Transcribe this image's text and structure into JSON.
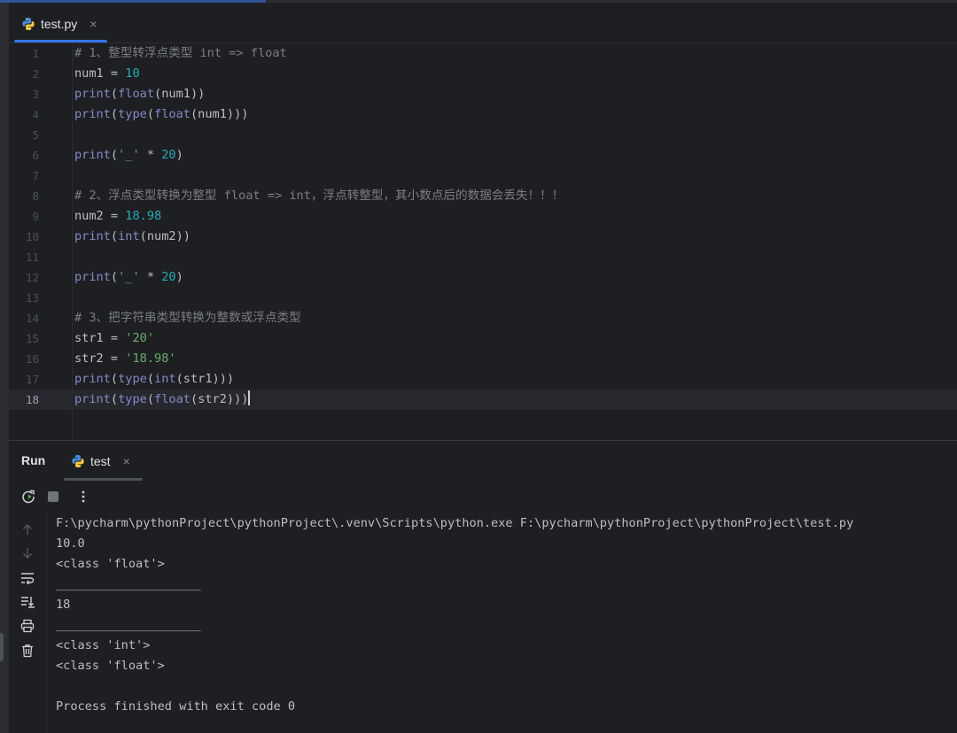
{
  "editor_tab": {
    "filename": "test.py",
    "close_glyph": "×",
    "icon": "python-file-icon"
  },
  "code_lines": [
    {
      "n": "1",
      "tokens": [
        {
          "t": "# 1、整型转浮点类型 int => float",
          "c": "comment"
        }
      ]
    },
    {
      "n": "2",
      "tokens": [
        {
          "t": "num1 = ",
          "c": "plain"
        },
        {
          "t": "10",
          "c": "number"
        }
      ]
    },
    {
      "n": "3",
      "tokens": [
        {
          "t": "print",
          "c": "builtin"
        },
        {
          "t": "(",
          "c": "plain"
        },
        {
          "t": "float",
          "c": "builtin"
        },
        {
          "t": "(num1))",
          "c": "plain"
        }
      ]
    },
    {
      "n": "4",
      "tokens": [
        {
          "t": "print",
          "c": "builtin"
        },
        {
          "t": "(",
          "c": "plain"
        },
        {
          "t": "type",
          "c": "builtin"
        },
        {
          "t": "(",
          "c": "plain"
        },
        {
          "t": "float",
          "c": "builtin"
        },
        {
          "t": "(num1)))",
          "c": "plain"
        }
      ]
    },
    {
      "n": "5",
      "tokens": []
    },
    {
      "n": "6",
      "tokens": [
        {
          "t": "print",
          "c": "builtin"
        },
        {
          "t": "(",
          "c": "plain"
        },
        {
          "t": "'_'",
          "c": "string"
        },
        {
          "t": " * ",
          "c": "plain"
        },
        {
          "t": "20",
          "c": "number"
        },
        {
          "t": ")",
          "c": "plain"
        }
      ]
    },
    {
      "n": "7",
      "tokens": []
    },
    {
      "n": "8",
      "tokens": [
        {
          "t": "# 2、浮点类型转换为整型 float => int，浮点转整型，其小数点后的数据会丢失！！！",
          "c": "comment"
        }
      ]
    },
    {
      "n": "9",
      "tokens": [
        {
          "t": "num2 = ",
          "c": "plain"
        },
        {
          "t": "18.98",
          "c": "number"
        }
      ]
    },
    {
      "n": "10",
      "tokens": [
        {
          "t": "print",
          "c": "builtin"
        },
        {
          "t": "(",
          "c": "plain"
        },
        {
          "t": "int",
          "c": "builtin"
        },
        {
          "t": "(num2))",
          "c": "plain"
        }
      ]
    },
    {
      "n": "11",
      "tokens": []
    },
    {
      "n": "12",
      "tokens": [
        {
          "t": "print",
          "c": "builtin"
        },
        {
          "t": "(",
          "c": "plain"
        },
        {
          "t": "'_'",
          "c": "string"
        },
        {
          "t": " * ",
          "c": "plain"
        },
        {
          "t": "20",
          "c": "number"
        },
        {
          "t": ")",
          "c": "plain"
        }
      ]
    },
    {
      "n": "13",
      "tokens": []
    },
    {
      "n": "14",
      "tokens": [
        {
          "t": "# 3、把字符串类型转换为整数或浮点类型",
          "c": "comment"
        }
      ]
    },
    {
      "n": "15",
      "tokens": [
        {
          "t": "str1 = ",
          "c": "plain"
        },
        {
          "t": "'20'",
          "c": "string"
        }
      ]
    },
    {
      "n": "16",
      "tokens": [
        {
          "t": "str2 = ",
          "c": "plain"
        },
        {
          "t": "'18.98'",
          "c": "string"
        }
      ]
    },
    {
      "n": "17",
      "tokens": [
        {
          "t": "print",
          "c": "builtin"
        },
        {
          "t": "(",
          "c": "plain"
        },
        {
          "t": "type",
          "c": "builtin"
        },
        {
          "t": "(",
          "c": "plain"
        },
        {
          "t": "int",
          "c": "builtin"
        },
        {
          "t": "(str1)))",
          "c": "plain"
        }
      ]
    },
    {
      "n": "18",
      "tokens": [
        {
          "t": "print",
          "c": "builtin"
        },
        {
          "t": "(",
          "c": "plain"
        },
        {
          "t": "type",
          "c": "builtin"
        },
        {
          "t": "(",
          "c": "plain"
        },
        {
          "t": "float",
          "c": "builtin"
        },
        {
          "t": "(str2)))",
          "c": "plain"
        }
      ],
      "current": true
    }
  ],
  "run_panel": {
    "title": "Run",
    "tab_label": "test",
    "close_glyph": "×",
    "toolbar": {
      "rerun_icon": "rerun-icon",
      "stop_icon": "stop-icon",
      "more_icon": "more-vertical-icon"
    },
    "rail_icons": [
      "arrow-up-icon",
      "arrow-down-icon",
      "soft-wrap-icon",
      "scroll-to-end-icon",
      "print-icon",
      "trash-icon"
    ]
  },
  "console_lines": [
    "F:\\pycharm\\pythonProject\\pythonProject\\.venv\\Scripts\\python.exe F:\\pycharm\\pythonProject\\pythonProject\\test.py",
    "10.0",
    "<class 'float'>",
    "____________________",
    "18",
    "____________________",
    "<class 'int'>",
    "<class 'float'>",
    "",
    "Process finished with exit code 0"
  ],
  "colors": {
    "background": "#1e1f22",
    "accent": "#3574f0",
    "comment": "#7a7e85",
    "number": "#2aacb8",
    "string": "#6aab73",
    "builtin": "#8888c6"
  }
}
